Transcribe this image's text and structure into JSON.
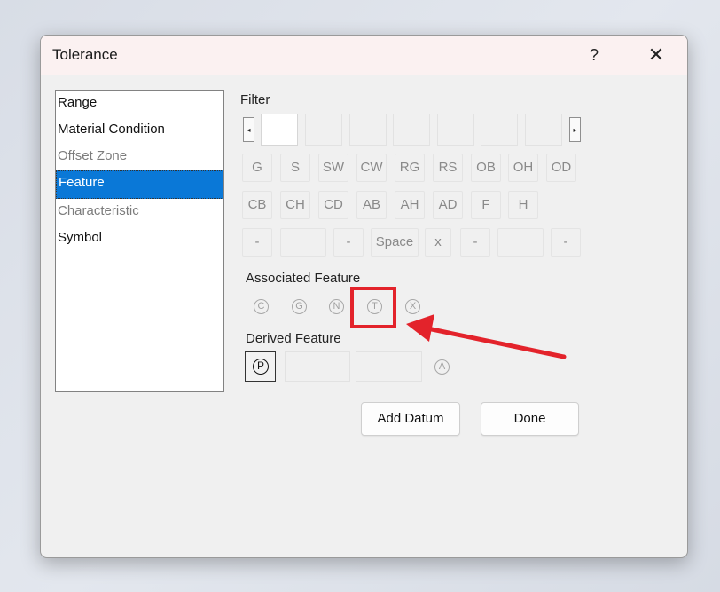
{
  "dialog": {
    "title": "Tolerance",
    "help": "?",
    "close": "✕"
  },
  "list": {
    "items": [
      {
        "label": "Range",
        "state": "normal"
      },
      {
        "label": "Material Condition",
        "state": "normal"
      },
      {
        "label": "Offset Zone",
        "state": "disabled"
      },
      {
        "label": "Feature",
        "state": "selected"
      },
      {
        "label": "Characteristic",
        "state": "disabled"
      },
      {
        "label": "Symbol",
        "state": "normal"
      }
    ]
  },
  "filter": {
    "label": "Filter",
    "scroll_left": "◂",
    "scroll_right": "▸"
  },
  "keys": {
    "row1": [
      "G",
      "S",
      "SW",
      "CW",
      "RG",
      "RS",
      "OB",
      "OH",
      "OD"
    ],
    "row2": [
      "CB",
      "CH",
      "CD",
      "AB",
      "AH",
      "AD",
      "F",
      "H"
    ],
    "row3": [
      "-",
      "",
      "-",
      "Space",
      "x",
      "-",
      "",
      "-"
    ]
  },
  "associated": {
    "label": "Associated Feature",
    "symbols": [
      "C",
      "G",
      "N",
      "T",
      "X"
    ]
  },
  "derived": {
    "label": "Derived Feature",
    "selected_symbol": "P",
    "extra_symbol": "A"
  },
  "buttons": {
    "add_datum": "Add Datum",
    "done": "Done"
  },
  "annotation": {
    "color": "#e3232b"
  }
}
